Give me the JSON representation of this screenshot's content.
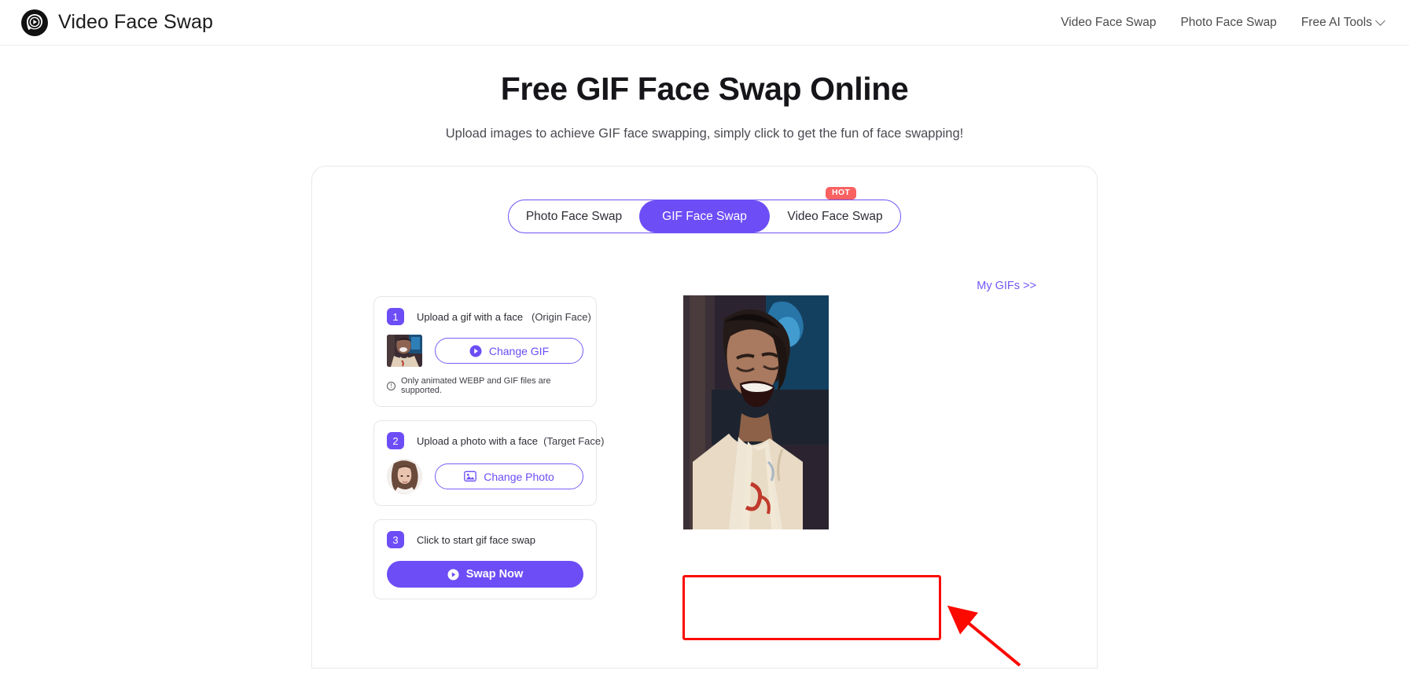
{
  "header": {
    "logo_icon": "face-swap-logo-icon",
    "brand_name": "Video Face Swap",
    "nav": [
      {
        "label": "Video Face Swap",
        "icon": null
      },
      {
        "label": "Photo Face Swap",
        "icon": null
      },
      {
        "label": "Free AI Tools",
        "icon": "chevron-down-icon"
      }
    ]
  },
  "hero": {
    "title": "Free GIF Face Swap Online",
    "subtitle": "Upload images to achieve GIF face swapping, simply click to get the fun of face swapping!"
  },
  "tabs": {
    "items": [
      {
        "label": "Photo Face Swap",
        "active": false,
        "badge": null
      },
      {
        "label": "GIF Face Swap",
        "active": true,
        "badge": null
      },
      {
        "label": "Video Face Swap",
        "active": false,
        "badge": "HOT"
      }
    ],
    "active_label": "GIF Face Swap",
    "badge_label": "HOT",
    "accent_color": "#6c4df6",
    "badge_color": "#fa6161"
  },
  "my_gifs": {
    "label": "My GIFs >>",
    "color": "#7357f6"
  },
  "steps": [
    {
      "number": "1",
      "title": "Upload a gif with a face",
      "subtitle": "(Origin Face)",
      "thumbnail": "origin-face-gif-thumbnail",
      "button_label": "Change GIF",
      "button_icon": "play-circle-icon",
      "note": "Only animated WEBP and GIF files are supported.",
      "note_icon": "info-circle-icon"
    },
    {
      "number": "2",
      "title": "Upload a photo with a face",
      "subtitle": "(Target Face)",
      "thumbnail": "target-face-photo-thumbnail",
      "button_label": "Change Photo",
      "button_icon": "image-icon",
      "note": null,
      "note_icon": null
    },
    {
      "number": "3",
      "title": "Click to start gif face swap",
      "subtitle": "",
      "thumbnail": null,
      "button_label": "Swap Now",
      "button_icon": "play-circle-icon",
      "note": null,
      "note_icon": null
    }
  ],
  "preview": {
    "name": "origin-gif-preview",
    "alt": "Laughing man in cream jacket against blue background"
  },
  "annotations": {
    "highlight_box_color": "#fb0a00",
    "arrow_color": "#fb0a00",
    "arrow_name": "red-pointer-arrow",
    "highlight_target": "step-2-card"
  }
}
